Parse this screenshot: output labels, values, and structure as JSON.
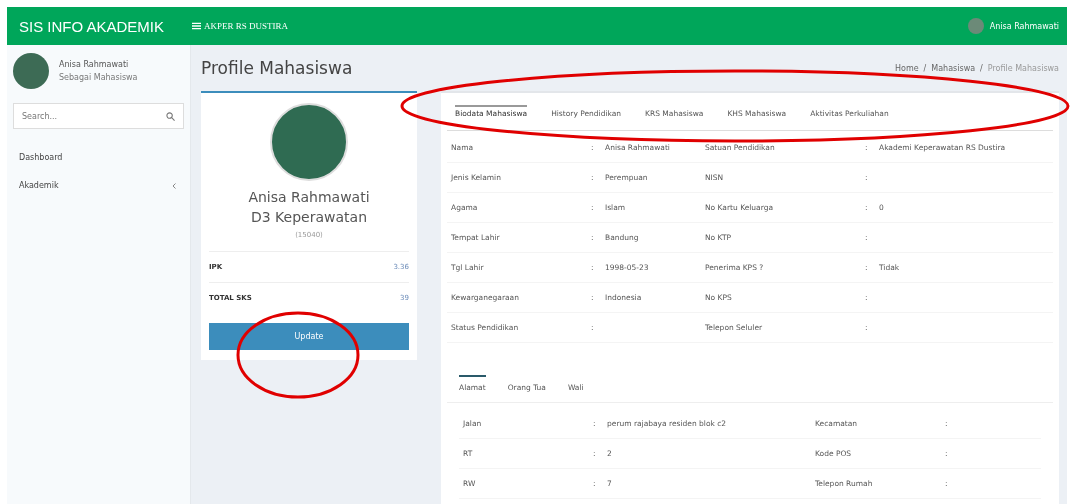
{
  "header": {
    "brand": "SIS INFO AKADEMIK",
    "institution": "AKPER RS DUSTIRA",
    "user": "Anisa Rahmawati"
  },
  "sidebar": {
    "user": {
      "name": "Anisa Rahmawati",
      "role": "Sebagai Mahasiswa"
    },
    "search": {
      "placeholder": "Search..."
    },
    "items": [
      {
        "label": "Dashboard",
        "expandable": false
      },
      {
        "label": "Akademik",
        "expandable": true
      }
    ]
  },
  "page_title": "Profile Mahasiswa",
  "breadcrumb": [
    {
      "label": "Home",
      "current": false
    },
    {
      "label": "Mahasiswa",
      "current": false
    },
    {
      "label": "Profile Mahasiswa",
      "current": true
    }
  ],
  "breadcrumb_separator": "/",
  "profile": {
    "name": "Anisa Rahmawati",
    "program": "D3 Keperawatan",
    "id": "(15040)",
    "stats": [
      {
        "label": "IPK",
        "value": "3.36"
      },
      {
        "label": "TOTAL SKS",
        "value": "39"
      }
    ],
    "button": "Update"
  },
  "separator": ":",
  "tabs": [
    {
      "label": "Biodata Mahasiswa",
      "selected": true
    },
    {
      "label": "History Pendidikan",
      "selected": false
    },
    {
      "label": "KRS Mahasiswa",
      "selected": false
    },
    {
      "label": "KHS Mahasiswa",
      "selected": false
    },
    {
      "label": "Aktivitas Perkuliahan",
      "selected": false
    }
  ],
  "biodata": [
    {
      "label": "Nama",
      "value": "Anisa Rahmawati",
      "label_2": "Satuan Pendidikan",
      "value_2": "Akademi Keperawatan RS Dustira"
    },
    {
      "label": "Jenis Kelamin",
      "value": "Perempuan",
      "label_2": "NISN"
    },
    {
      "label": "Agama",
      "value": "Islam",
      "label_2": "No Kartu Keluarga",
      "value_2": "0"
    },
    {
      "label": "Tempat Lahir",
      "value": "Bandung",
      "label_2": "No KTP"
    },
    {
      "label": "Tgl Lahir",
      "value": "1998-05-23",
      "label_2": "Penerima KPS ?",
      "value_2": "Tidak"
    },
    {
      "label": "Kewarganegaraan",
      "value": "Indonesia",
      "label_2": "No KPS"
    },
    {
      "label": "Status Pendidikan",
      "label_2": "Telepon Seluler"
    }
  ],
  "sub_tabs": [
    {
      "label": "Alamat",
      "selected": true
    },
    {
      "label": "Orang Tua",
      "selected": false
    },
    {
      "label": "Wali",
      "selected": false
    }
  ],
  "address": [
    {
      "label": "Jalan",
      "value": "perum rajabaya residen blok c2",
      "label_2": "Kecamatan"
    },
    {
      "label": "RT",
      "value": "2",
      "label_2": "Kode POS"
    },
    {
      "label": "RW",
      "value": "7",
      "label_2": "Telepon Rumah"
    }
  ],
  "annotations": [
    {
      "kind": "ellipse"
    },
    {
      "kind": "ellipse"
    }
  ]
}
